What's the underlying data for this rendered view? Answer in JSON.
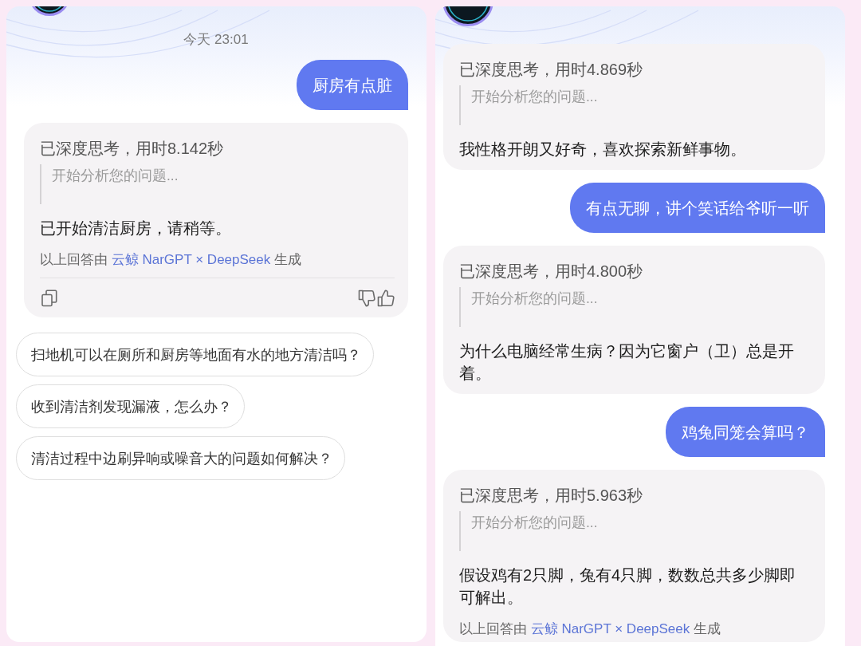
{
  "panels": [
    {
      "messages": [
        {
          "kind": "timestamp",
          "text": "今天 23:01"
        },
        {
          "kind": "user",
          "text": "厨房有点脏"
        },
        {
          "kind": "assistant",
          "thinking_status": "已深度思考，用时8.142秒",
          "thinking": "开始分析您的问题...",
          "answer": "已开始清洁厨房，请稍等。",
          "attribution": {
            "prefix": "以上回答由",
            "model": "云鲸 NarGPT × DeepSeek",
            "suffix": "生成"
          },
          "actions": true
        }
      ],
      "suggestions": [
        "扫地机可以在厕所和厨房等地面有水的地方清洁吗？",
        "收到清洁剂发现漏液，怎么办？",
        "清洁过程中边刷异响或噪音大的问题如何解决？"
      ]
    },
    {
      "messages": [
        {
          "kind": "assistant",
          "thinking_status": "已深度思考，用时4.869秒",
          "thinking": "开始分析您的问题...",
          "answer": "我性格开朗又好奇，喜欢探索新鲜事物。",
          "actions": false
        },
        {
          "kind": "user",
          "text": "有点无聊，讲个笑话给爷听一听"
        },
        {
          "kind": "assistant",
          "thinking_status": "已深度思考，用时4.800秒",
          "thinking": "开始分析您的问题...",
          "answer": "为什么电脑经常生病？因为它窗户（卫）总是开着。",
          "actions": false
        },
        {
          "kind": "user",
          "text": "鸡兔同笼会算吗？"
        },
        {
          "kind": "assistant",
          "thinking_status": "已深度思考，用时5.963秒",
          "thinking": "开始分析您的问题...",
          "answer": "假设鸡有2只脚，兔有4只脚，数数总共多少脚即可解出。",
          "attribution": {
            "prefix": "以上回答由",
            "model": "云鲸 NarGPT × DeepSeek",
            "suffix": "生成"
          },
          "actions": false
        }
      ]
    }
  ]
}
